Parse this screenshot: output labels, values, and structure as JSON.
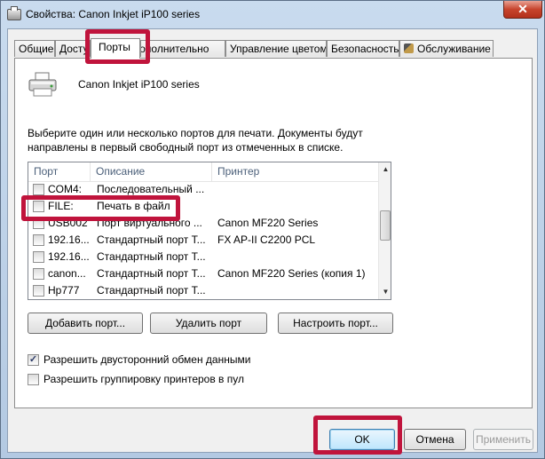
{
  "window": {
    "title": "Свойства: Canon Inkjet iP100 series",
    "close_label": "✕"
  },
  "tabs": [
    {
      "label": "Общие"
    },
    {
      "label": "Доступ"
    },
    {
      "label": "Порты"
    },
    {
      "label": "Дополнительно"
    },
    {
      "label": "Управление цветом"
    },
    {
      "label": "Безопасность"
    },
    {
      "label": "Обслуживание"
    }
  ],
  "printer": {
    "name": "Canon Inkjet iP100 series",
    "icon": "printer-icon"
  },
  "instructions": "Выберите один или несколько портов для печати. Документы будут направлены в первый свободный порт из отмеченных в списке.",
  "ports": {
    "columns": [
      "Порт",
      "Описание",
      "Принтер"
    ],
    "rows": [
      {
        "port": "COM4:",
        "description": "Последовательный ...",
        "printer": "",
        "checked": false
      },
      {
        "port": "FILE:",
        "description": "Печать в файл",
        "printer": "",
        "checked": false
      },
      {
        "port": "USB002",
        "description": "Порт виртуального ...",
        "printer": "Canon MF220 Series",
        "checked": false
      },
      {
        "port": "192.16...",
        "description": "Стандартный порт T...",
        "printer": "FX AP-II C2200 PCL",
        "checked": false
      },
      {
        "port": "192.16...",
        "description": "Стандартный порт T...",
        "printer": "",
        "checked": false
      },
      {
        "port": "canon...",
        "description": "Стандартный порт T...",
        "printer": "Canon MF220 Series (копия 1)",
        "checked": false
      },
      {
        "port": "Hp777",
        "description": "Стандартный порт T...",
        "printer": "",
        "checked": false
      }
    ]
  },
  "buttons": {
    "add_port": "Добавить порт...",
    "delete_port": "Удалить порт",
    "configure_port": "Настроить порт..."
  },
  "options": {
    "bidirectional": {
      "label": "Разрешить двусторонний обмен данными",
      "checked": true
    },
    "pooling": {
      "label": "Разрешить группировку принтеров в пул",
      "checked": false
    }
  },
  "footer": {
    "ok": "OK",
    "cancel": "Отмена",
    "apply": "Применить"
  },
  "colors": {
    "highlight": "#c0143c",
    "title_bar": "#c9dbee"
  }
}
